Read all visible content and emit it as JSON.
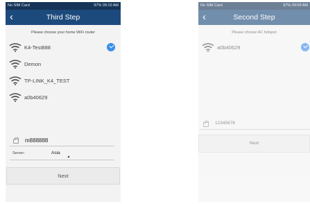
{
  "left": {
    "status": {
      "carrier": "No SIM Card",
      "right": "97% 09:10 AM"
    },
    "title": "Third Step",
    "prompt": "Please choose your home WiFi router",
    "networks": [
      "K4-Test888",
      "Demon",
      "TP-LINK_K4_TEST",
      "a0b40629"
    ],
    "selected_index": 0,
    "password": "m888888",
    "server_label": "Server:",
    "server_value": "Asia",
    "next_label": "Next"
  },
  "right": {
    "status": {
      "carrier": "No SIM Card",
      "right": "97% 09:09 AM"
    },
    "title": "Second Step",
    "prompt": "Please choose AC hotspot",
    "networks": [
      "a0b40629"
    ],
    "selected_index": 0,
    "password": "12345678",
    "next_label": "Next"
  },
  "icons": [
    "back-arrow-icon",
    "wifi-icon",
    "check-icon",
    "lock-icon",
    "dropdown-triangle-icon"
  ],
  "colors": {
    "header": "#1d4a7c",
    "status_bar": "#163457",
    "check": "#3a8ee6",
    "button": "#ebebeb"
  }
}
